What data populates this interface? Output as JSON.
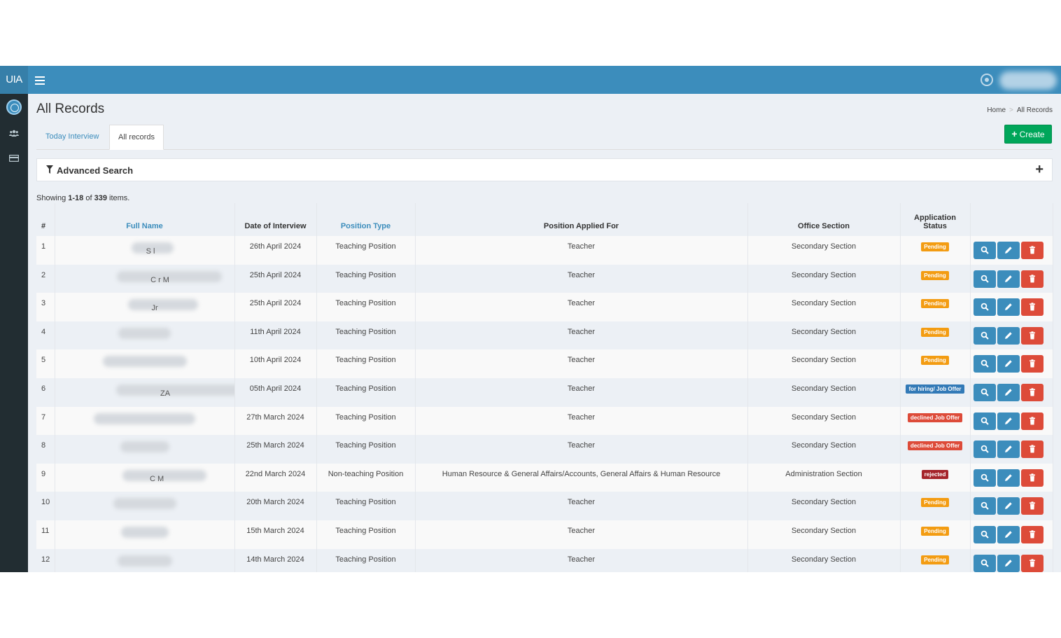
{
  "app": {
    "logo_text": "UIA",
    "hamburger_icon": "hamburger-icon",
    "profile_icon": "profile-icon",
    "user_name": "██████"
  },
  "sidebar": {
    "items": [
      {
        "icon": "brand-logo-icon"
      },
      {
        "icon": "users-icon"
      },
      {
        "icon": "card-icon"
      }
    ]
  },
  "page": {
    "title": "All Records",
    "breadcrumb": {
      "home": "Home",
      "current": "All Records"
    }
  },
  "tabs": {
    "today": "Today Interview",
    "all": "All records",
    "active": "all"
  },
  "toolbar": {
    "create_label": "Create"
  },
  "advanced_search": {
    "title": "Advanced Search",
    "expand_icon": "plus-icon"
  },
  "summary": {
    "prefix": "Showing",
    "range": "1-18",
    "middle": "of",
    "total": "339",
    "suffix": "items."
  },
  "table": {
    "headers": {
      "num": "#",
      "full_name": "Full Name",
      "date": "Date of Interview",
      "position_type": "Position Type",
      "applied_for": "Position Applied For",
      "office": "Office Section",
      "status": "Application Status"
    },
    "rows": [
      {
        "num": "1",
        "name_visible": "S    l",
        "date": "26th April 2024",
        "type": "Teaching Position",
        "applied": "Teacher",
        "office": "Secondary Section",
        "status": "Pending",
        "status_kind": "pending"
      },
      {
        "num": "2",
        "name_visible": "C    r    M",
        "date": "25th April 2024",
        "type": "Teaching Position",
        "applied": "Teacher",
        "office": "Secondary Section",
        "status": "Pending",
        "status_kind": "pending"
      },
      {
        "num": "3",
        "name_visible": "Jr",
        "date": "25th April 2024",
        "type": "Teaching Position",
        "applied": "Teacher",
        "office": "Secondary Section",
        "status": "Pending",
        "status_kind": "pending"
      },
      {
        "num": "4",
        "name_visible": "",
        "date": "11th April 2024",
        "type": "Teaching Position",
        "applied": "Teacher",
        "office": "Secondary Section",
        "status": "Pending",
        "status_kind": "pending"
      },
      {
        "num": "5",
        "name_visible": "",
        "date": "10th April 2024",
        "type": "Teaching Position",
        "applied": "Teacher",
        "office": "Secondary Section",
        "status": "Pending",
        "status_kind": "pending"
      },
      {
        "num": "6",
        "name_visible": "ZA",
        "date": "05th April 2024",
        "type": "Teaching Position",
        "applied": "Teacher",
        "office": "Secondary Section",
        "status": "for hiring/ Job Offer",
        "status_kind": "hiring"
      },
      {
        "num": "7",
        "name_visible": "",
        "date": "27th March 2024",
        "type": "Teaching Position",
        "applied": "Teacher",
        "office": "Secondary Section",
        "status": "declined Job Offer",
        "status_kind": "declined"
      },
      {
        "num": "8",
        "name_visible": "",
        "date": "25th March 2024",
        "type": "Teaching Position",
        "applied": "Teacher",
        "office": "Secondary Section",
        "status": "declined Job Offer",
        "status_kind": "declined"
      },
      {
        "num": "9",
        "name_visible": "C    M",
        "date": "22nd March 2024",
        "type": "Non-teaching Position",
        "applied": "Human Resource & General Affairs/Accounts, General Affairs & Human Resource",
        "office": "Administration Section",
        "status": "rejected",
        "status_kind": "rejected"
      },
      {
        "num": "10",
        "name_visible": "",
        "date": "20th March 2024",
        "type": "Teaching Position",
        "applied": "Teacher",
        "office": "Secondary Section",
        "status": "Pending",
        "status_kind": "pending"
      },
      {
        "num": "11",
        "name_visible": "",
        "date": "15th March 2024",
        "type": "Teaching Position",
        "applied": "Teacher",
        "office": "Secondary Section",
        "status": "Pending",
        "status_kind": "pending"
      },
      {
        "num": "12",
        "name_visible": "",
        "date": "14th March 2024",
        "type": "Teaching Position",
        "applied": "Teacher",
        "office": "Secondary Section",
        "status": "Pending",
        "status_kind": "pending"
      }
    ]
  },
  "colors": {
    "topbar": "#3c8dbc",
    "sidebar": "#222d32",
    "create": "#00a65a",
    "pending": "#f39c12",
    "hiring": "#337ab7",
    "declined": "#dd4b39",
    "rejected": "#a5242a"
  }
}
